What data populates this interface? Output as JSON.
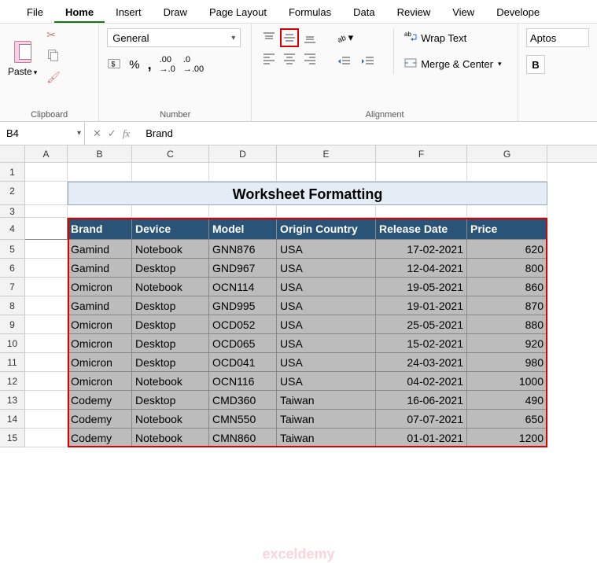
{
  "menu": {
    "items": [
      "File",
      "Home",
      "Insert",
      "Draw",
      "Page Layout",
      "Formulas",
      "Data",
      "Review",
      "View",
      "Develope"
    ],
    "active": "Home"
  },
  "ribbon": {
    "clipboard": {
      "paste": "Paste",
      "label": "Clipboard"
    },
    "number": {
      "format": "General",
      "label": "Number"
    },
    "alignment": {
      "wrap": "Wrap Text",
      "merge": "Merge & Center",
      "label": "Alignment"
    },
    "font": {
      "name": "Aptos"
    }
  },
  "namebox": "B4",
  "formula": "Brand",
  "title": "Worksheet Formatting",
  "columns": [
    "A",
    "B",
    "C",
    "D",
    "E",
    "F",
    "G"
  ],
  "headers": {
    "b": "Brand",
    "c": "Device",
    "d": "Model",
    "e": "Origin Country",
    "f": "Release Date",
    "g": "Price"
  },
  "rows": [
    {
      "n": "5",
      "b": "Gamind",
      "c": "Notebook",
      "d": "GNN876",
      "e": "USA",
      "f": "17-02-2021",
      "g": "620"
    },
    {
      "n": "6",
      "b": "Gamind",
      "c": "Desktop",
      "d": "GND967",
      "e": "USA",
      "f": "12-04-2021",
      "g": "800"
    },
    {
      "n": "7",
      "b": "Omicron",
      "c": "Notebook",
      "d": "OCN114",
      "e": "USA",
      "f": "19-05-2021",
      "g": "860"
    },
    {
      "n": "8",
      "b": "Gamind",
      "c": "Desktop",
      "d": "GND995",
      "e": "USA",
      "f": "19-01-2021",
      "g": "870"
    },
    {
      "n": "9",
      "b": "Omicron",
      "c": "Desktop",
      "d": "OCD052",
      "e": "USA",
      "f": "25-05-2021",
      "g": "880"
    },
    {
      "n": "10",
      "b": "Omicron",
      "c": "Desktop",
      "d": "OCD065",
      "e": "USA",
      "f": "15-02-2021",
      "g": "920"
    },
    {
      "n": "11",
      "b": "Omicron",
      "c": "Desktop",
      "d": "OCD041",
      "e": "USA",
      "f": "24-03-2021",
      "g": "980"
    },
    {
      "n": "12",
      "b": "Omicron",
      "c": "Notebook",
      "d": "OCN116",
      "e": "USA",
      "f": "04-02-2021",
      "g": "1000"
    },
    {
      "n": "13",
      "b": "Codemy",
      "c": "Desktop",
      "d": "CMD360",
      "e": "Taiwan",
      "f": "16-06-2021",
      "g": "490"
    },
    {
      "n": "14",
      "b": "Codemy",
      "c": "Notebook",
      "d": "CMN550",
      "e": "Taiwan",
      "f": "07-07-2021",
      "g": "650"
    },
    {
      "n": "15",
      "b": "Codemy",
      "c": "Notebook",
      "d": "CMN860",
      "e": "Taiwan",
      "f": "01-01-2021",
      "g": "1200"
    }
  ],
  "watermark": "exceldemy"
}
